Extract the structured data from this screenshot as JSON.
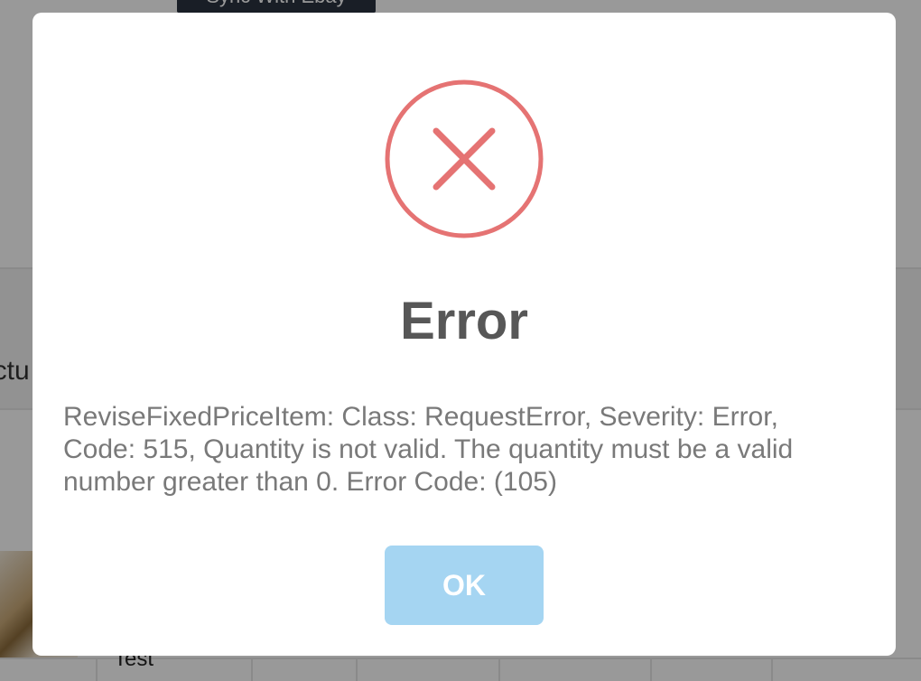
{
  "background": {
    "top_button_label": "Sync With Ebay",
    "column_header_fragment": "ictu",
    "row_cell_text": "Test"
  },
  "dialog": {
    "title": "Error",
    "message": "ReviseFixedPriceItem: Class: RequestError, Severity: Error, Code: 515, Quantity is not valid. The quantity must be a valid number greater than 0. Error Code: (105)",
    "ok_label": "OK",
    "icon": "error-x-circle-icon",
    "colors": {
      "icon_stroke": "#e57373",
      "title": "#575757",
      "message": "#797979",
      "ok_button_bg": "#a5d5f2"
    }
  }
}
